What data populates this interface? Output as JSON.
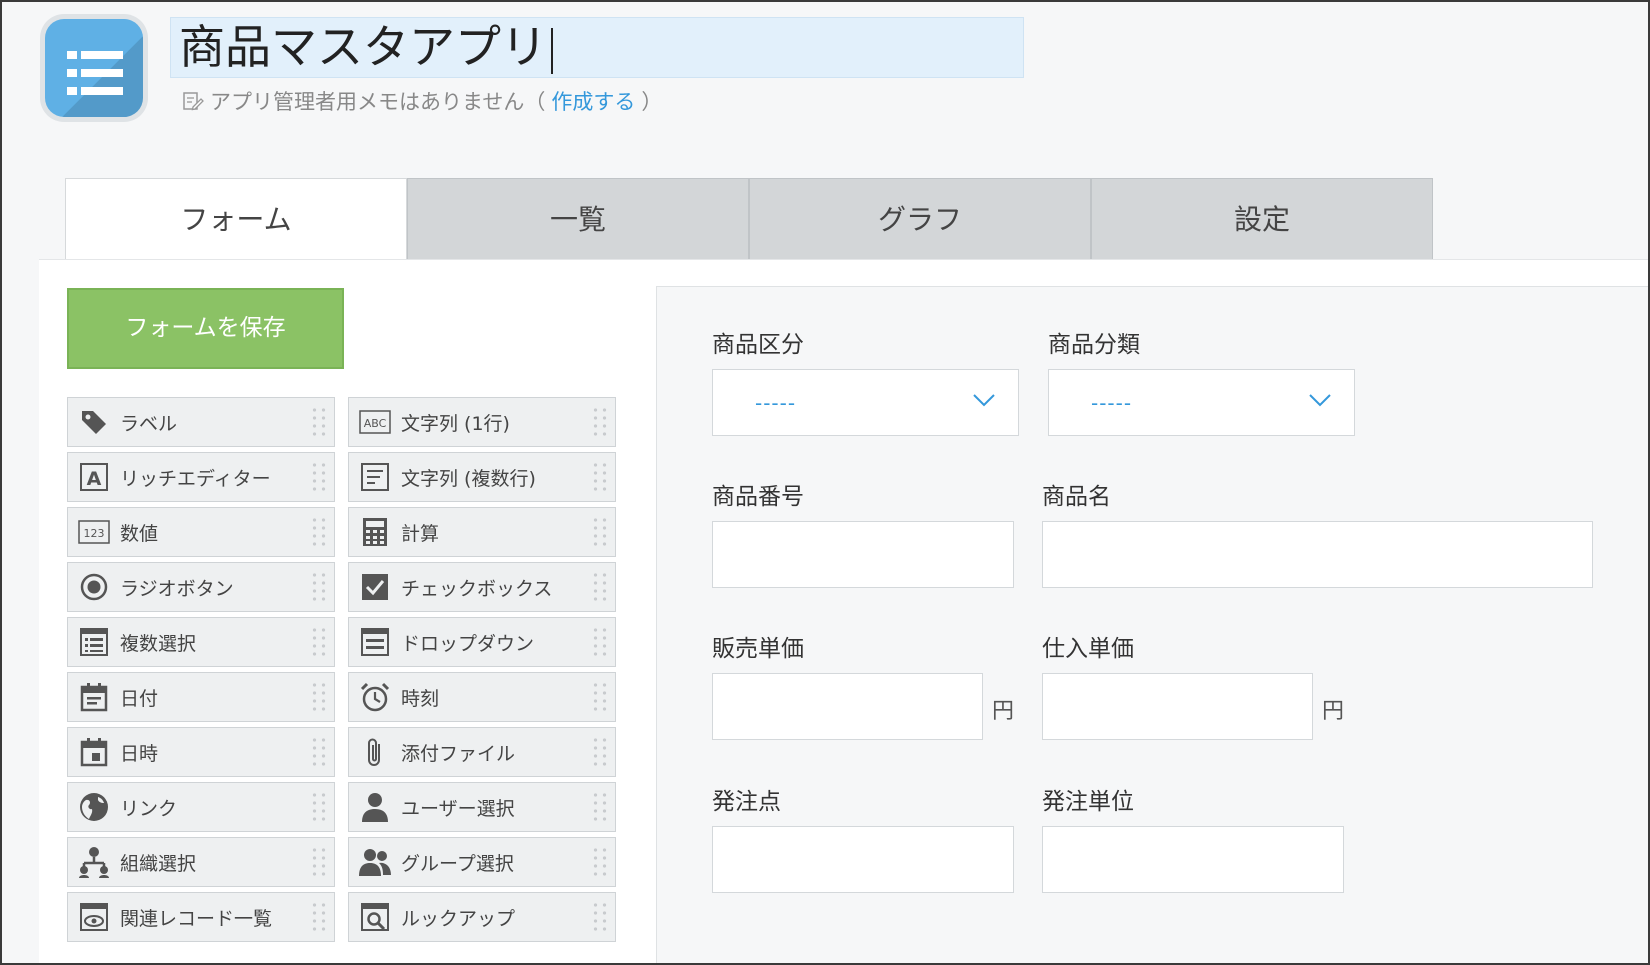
{
  "app": {
    "title": "商品マスタアプリ",
    "memo_text": "アプリ管理者用メモはありません（",
    "memo_link": "作成する",
    "memo_close": "）"
  },
  "tabs": [
    {
      "label": "フォーム",
      "active": true
    },
    {
      "label": "一覧",
      "active": false
    },
    {
      "label": "グラフ",
      "active": false
    },
    {
      "label": "設定",
      "active": false
    }
  ],
  "save_button": "フォームを保存",
  "palette": [
    {
      "label": "ラベル",
      "icon": "tag-icon"
    },
    {
      "label": "文字列 (1行)",
      "icon": "abc-icon"
    },
    {
      "label": "リッチエディター",
      "icon": "rich-editor-icon"
    },
    {
      "label": "文字列 (複数行)",
      "icon": "multiline-text-icon"
    },
    {
      "label": "数値",
      "icon": "number-icon"
    },
    {
      "label": "計算",
      "icon": "calculator-icon"
    },
    {
      "label": "ラジオボタン",
      "icon": "radio-icon"
    },
    {
      "label": "チェックボックス",
      "icon": "checkbox-icon"
    },
    {
      "label": "複数選択",
      "icon": "multi-select-icon"
    },
    {
      "label": "ドロップダウン",
      "icon": "dropdown-icon"
    },
    {
      "label": "日付",
      "icon": "date-icon"
    },
    {
      "label": "時刻",
      "icon": "clock-icon"
    },
    {
      "label": "日時",
      "icon": "datetime-icon"
    },
    {
      "label": "添付ファイル",
      "icon": "paperclip-icon"
    },
    {
      "label": "リンク",
      "icon": "globe-icon"
    },
    {
      "label": "ユーザー選択",
      "icon": "user-icon"
    },
    {
      "label": "組織選択",
      "icon": "org-icon"
    },
    {
      "label": "グループ選択",
      "icon": "group-icon"
    },
    {
      "label": "関連レコード一覧",
      "icon": "related-records-icon"
    },
    {
      "label": "ルックアップ",
      "icon": "lookup-icon"
    }
  ],
  "form": {
    "product_category": {
      "label": "商品区分",
      "value": "-----"
    },
    "product_class": {
      "label": "商品分類",
      "value": "-----"
    },
    "product_code": {
      "label": "商品番号"
    },
    "product_name": {
      "label": "商品名"
    },
    "sale_price": {
      "label": "販売単価",
      "unit": "円"
    },
    "cost_price": {
      "label": "仕入単価",
      "unit": "円"
    },
    "reorder_point": {
      "label": "発注点"
    },
    "order_unit": {
      "label": "発注単位"
    }
  },
  "colors": {
    "save_button": "#8bc265",
    "app_icon": "#5fb0e5",
    "title_highlight": "#e2f0fb",
    "link": "#3498db"
  }
}
